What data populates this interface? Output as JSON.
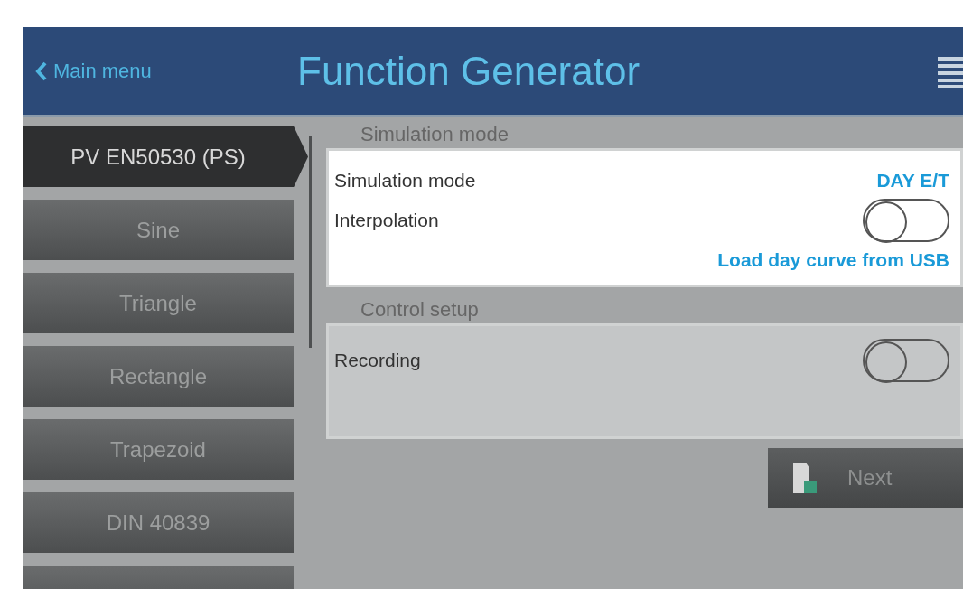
{
  "header": {
    "back_label": "Main menu",
    "title": "Function Generator"
  },
  "sidebar": {
    "items": [
      {
        "label": "PV EN50530 (PS)",
        "selected": true
      },
      {
        "label": "Sine",
        "selected": false
      },
      {
        "label": "Triangle",
        "selected": false
      },
      {
        "label": "Rectangle",
        "selected": false
      },
      {
        "label": "Trapezoid",
        "selected": false
      },
      {
        "label": "DIN 40839",
        "selected": false
      }
    ]
  },
  "sections": [
    {
      "title": "Simulation mode",
      "highlighted": true,
      "rows": [
        {
          "kind": "value",
          "label": "Simulation mode",
          "value": "DAY E/T"
        },
        {
          "kind": "toggle",
          "label": "Interpolation",
          "on": false
        },
        {
          "kind": "link",
          "label": "Load day curve from USB"
        }
      ]
    },
    {
      "title": "Control setup",
      "highlighted": false,
      "rows": [
        {
          "kind": "toggle",
          "label": "Recording",
          "on": false
        }
      ]
    }
  ],
  "next_button": {
    "label": "Next"
  }
}
